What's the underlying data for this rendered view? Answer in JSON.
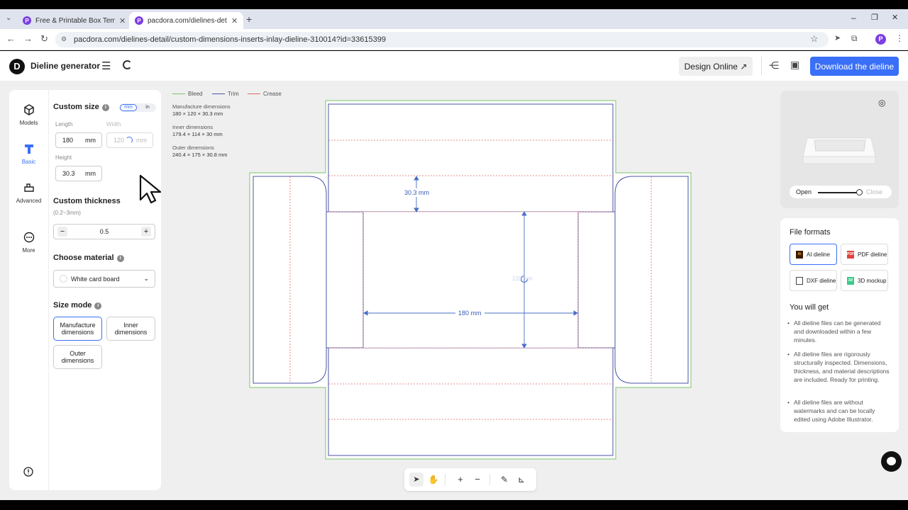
{
  "browser": {
    "tabs": [
      {
        "title": "Free & Printable Box Templat",
        "active": false
      },
      {
        "title": "pacdora.com/dielines-detail/",
        "active": true
      }
    ],
    "url": "pacdora.com/dielines-detail/custom-dimensions-inserts-inlay-dieline-310014?id=33615399"
  },
  "header": {
    "logo_letter": "D",
    "title": "Dieline generator",
    "design_online": "Design Online ↗",
    "download": "Download the dieline",
    "accent": "#3a6ff7"
  },
  "nav": {
    "items": [
      {
        "label": "Models",
        "icon": "cube-icon"
      },
      {
        "label": "Basic",
        "icon": "ruler-icon",
        "active": true
      },
      {
        "label": "Advanced",
        "icon": "advanced-icon"
      },
      {
        "label": "More",
        "icon": "more-icon"
      }
    ]
  },
  "panel": {
    "custom_size": "Custom size",
    "unit_mm": "mm",
    "unit_in": "in",
    "length_label": "Length",
    "length_value": "180",
    "width_label": "Width",
    "width_value": "120",
    "height_label": "Height",
    "height_value": "30.3",
    "field_unit": "mm",
    "custom_thickness": "Custom thickness",
    "thickness_range": "(0.2~3mm)",
    "thickness_value": "0.5",
    "minus": "−",
    "plus": "+",
    "choose_material": "Choose material",
    "material": "White card board",
    "size_mode": "Size mode",
    "modes": [
      "Manufacture dimensions",
      "Inner dimensions",
      "Outer dimensions"
    ],
    "active_mode": 0
  },
  "canvas": {
    "legend": [
      {
        "label": "Bleed",
        "color": "#7cc46a"
      },
      {
        "label": "Trim",
        "color": "#4a56a6"
      },
      {
        "label": "Crease",
        "color": "#e06a6a"
      }
    ],
    "manufacture_label": "Manufacture dimensions",
    "manufacture_value": "180 × 120 × 30.3 mm",
    "inner_label": "Inner dimensions",
    "inner_value": "179.4 × 114 × 30 mm",
    "outer_label": "Outer dimensions",
    "outer_value": "240.4 × 175 × 30.8 mm",
    "dim_height": "30.3 mm",
    "dim_length": "180 mm",
    "dim_width": "120 mm"
  },
  "preview": {
    "open": "Open",
    "close": "Close",
    "slider_level": 1.0
  },
  "formats": {
    "title": "File formats",
    "buttons": [
      {
        "label": "AI dieline",
        "icon": "ai-icon",
        "tag": "Ai",
        "color": "#3b1a00",
        "selected": true
      },
      {
        "label": "PDF dieline",
        "icon": "pdf-icon",
        "tag": "PDF",
        "color": "#e0443e",
        "selected": false
      },
      {
        "label": "DXF dieline",
        "icon": "dxf-icon",
        "tag": "",
        "color": "#444444",
        "selected": false
      },
      {
        "label": "3D mockup",
        "icon": "mockup-icon",
        "tag": "3D",
        "color": "#3cc98b",
        "selected": false
      }
    ],
    "you_will_get": "You will get",
    "bullets": [
      "All dieline files can be generated and downloaded within a few minutes.",
      "All dieline files are rigorously structurally inspected. Dimensions, thickness, and material descriptions are included. Ready for printing.",
      "All dieline files are without watermarks and can be locally edited using Adobe Illustrator."
    ]
  }
}
